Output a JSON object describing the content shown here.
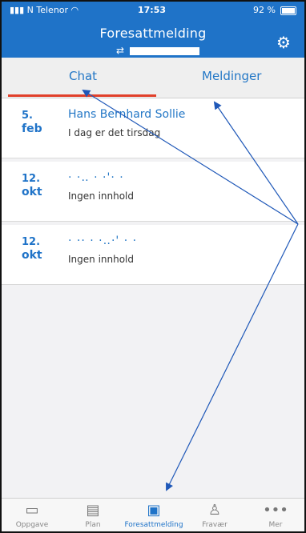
{
  "status_bar": {
    "carrier": "N Telenor",
    "time": "17:53",
    "battery": "92 %"
  },
  "header": {
    "title": "Foresattmelding",
    "sub_icon": "swap-arrows-icon",
    "settings_icon": "gear-icon"
  },
  "tabs": [
    {
      "label": "Chat",
      "active": true
    },
    {
      "label": "Meldinger",
      "active": false
    }
  ],
  "messages": [
    {
      "day": "5.",
      "month": "feb",
      "name": "Hans Bernhard Sollie",
      "preview": "I dag er det tirsdag"
    },
    {
      "day": "12.",
      "month": "okt",
      "name": "",
      "preview": "Ingen innhold"
    },
    {
      "day": "12.",
      "month": "okt",
      "name": "",
      "preview": "Ingen innhold"
    }
  ],
  "bottom_tabs": [
    {
      "label": "Oppgave",
      "icon": "task-icon",
      "active": false
    },
    {
      "label": "Plan",
      "icon": "plan-icon",
      "active": false
    },
    {
      "label": "Foresattmelding",
      "icon": "chat-icon",
      "active": true
    },
    {
      "label": "Fravær",
      "icon": "absence-icon",
      "active": false
    },
    {
      "label": "Mer",
      "icon": "more-icon",
      "active": false
    }
  ],
  "colors": {
    "brand": "#1f73c8",
    "tab_indicator": "#e1402a",
    "annotation_arrow": "#1f58b8"
  }
}
